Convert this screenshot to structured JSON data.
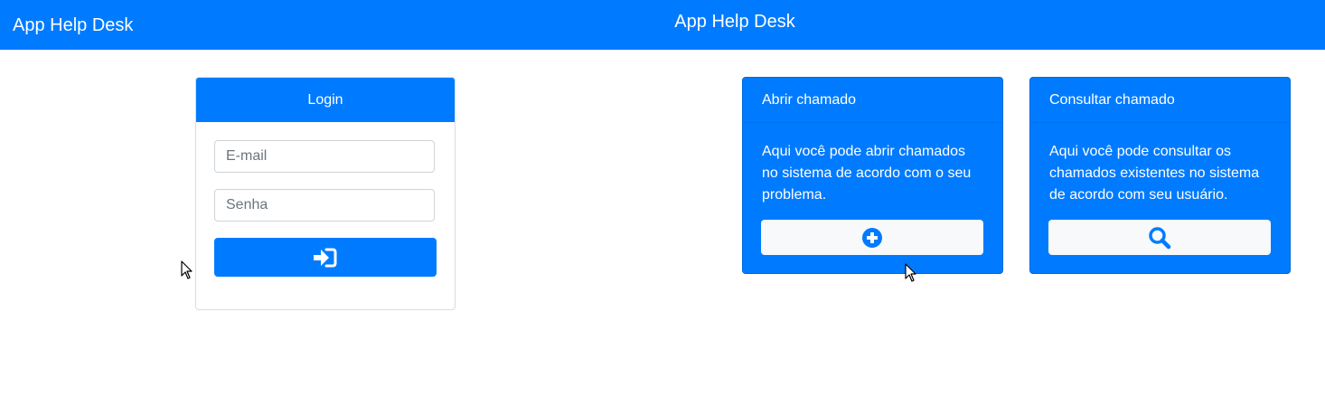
{
  "navbar": {
    "brand": "App Help Desk",
    "title": "App Help Desk"
  },
  "login": {
    "title": "Login",
    "email_placeholder": "E-mail",
    "password_placeholder": "Senha",
    "submit_icon": "sign-in-icon"
  },
  "cards": [
    {
      "title": "Abrir chamado",
      "text": "Aqui você pode abrir chamados no sistema de acordo com o seu problema.",
      "button_icon": "plus-circle-icon"
    },
    {
      "title": "Consultar chamado",
      "text": "Aqui você pode consultar os chamados existentes no sistema de acordo com seu usuário.",
      "button_icon": "search-icon"
    }
  ],
  "colors": {
    "primary": "#007bff",
    "button_light": "#f8f9fa"
  }
}
